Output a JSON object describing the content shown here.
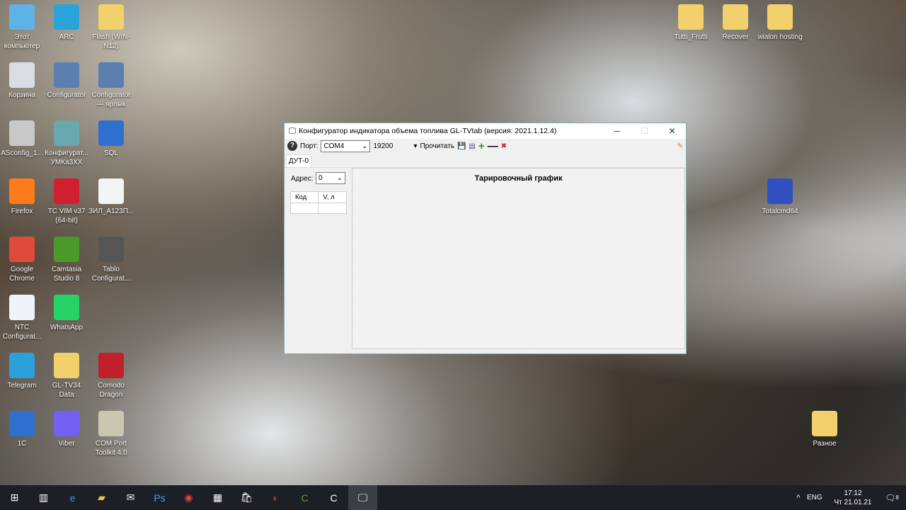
{
  "desktop_icons": [
    {
      "label": "Этот компьютер",
      "icon": "computer-icon",
      "color": "#5bb3e8"
    },
    {
      "label": "ARC",
      "icon": "arc-icon",
      "color": "#2aa3d8"
    },
    {
      "label": "Flash (WIN-N12)",
      "icon": "folder-icon",
      "color": "#f2d06b"
    },
    {
      "label": "Корзина",
      "icon": "recycle-bin-icon",
      "color": "#d8dde3"
    },
    {
      "label": "Configurator",
      "icon": "tools-icon",
      "color": "#5a7fb0"
    },
    {
      "label": "Configurator — ярлык",
      "icon": "tools-icon",
      "color": "#5a7fb0"
    },
    {
      "label": "ASconfig_1...",
      "icon": "gear-icon",
      "color": "#c8c8c8"
    },
    {
      "label": "Конфигурат... УМКа3XX",
      "icon": "configurator-icon",
      "color": "#6aa8b0"
    },
    {
      "label": "SQL",
      "icon": "network-computer-icon",
      "color": "#2f6fd0"
    },
    {
      "label": "Firefox",
      "icon": "firefox-icon",
      "color": "#ff7a1a"
    },
    {
      "label": "TC VIM v37 (64-bit)",
      "icon": "vim-icon",
      "color": "#d02030"
    },
    {
      "label": "ЗИЛ_А123П...",
      "icon": "document-icon",
      "color": "#f4f4f4"
    },
    {
      "label": "Google Chrome",
      "icon": "chrome-icon",
      "color": "#e04a3a"
    },
    {
      "label": "Camtasia Studio 8",
      "icon": "camtasia-icon",
      "color": "#4a9a2a"
    },
    {
      "label": "Tablo Configurat...",
      "icon": "monitor-icon",
      "color": "#555555"
    },
    {
      "label": "NTC Configurat...",
      "icon": "cfg-icon",
      "color": "#eef4fa"
    },
    {
      "label": "WhatsApp",
      "icon": "whatsapp-icon",
      "color": "#25d366"
    },
    {
      "label": "Telegram",
      "icon": "telegram-icon",
      "color": "#2aa1da"
    },
    {
      "label": "GL-TV34 Data",
      "icon": "folder-icon",
      "color": "#f2d06b"
    },
    {
      "label": "Comodo Dragon",
      "icon": "comodo-icon",
      "color": "#c0202a"
    },
    {
      "label": "1C",
      "icon": "network-computer-icon",
      "color": "#2f6fd0"
    },
    {
      "label": "Viber",
      "icon": "viber-icon",
      "color": "#7360f2"
    },
    {
      "label": "COM Port Toolkit 4.0",
      "icon": "com-port-icon",
      "color": "#c8c8b0"
    },
    {
      "label": "Tutti_Frutti",
      "icon": "folder-icon",
      "color": "#f2d06b"
    },
    {
      "label": "Recover",
      "icon": "folder-icon",
      "color": "#f2d06b"
    },
    {
      "label": "wialon hosting",
      "icon": "folder-icon",
      "color": "#f2d06b"
    },
    {
      "label": "Totalcmd64",
      "icon": "totalcmd-icon",
      "color": "#3050c0"
    },
    {
      "label": "Разное",
      "icon": "folder-icon",
      "color": "#f2d06b"
    }
  ],
  "window": {
    "title": "Конфигуратор индикатора объема топлива GL-TVtab (версия: 2021.1.12.4)",
    "port_label": "Порт:",
    "port_value": "COM4",
    "baud_value": "19200",
    "read_label": "Прочитать",
    "tab": "ДУТ-0",
    "address_label": "Адрес:",
    "address_value": "0",
    "table_headers": [
      "Код",
      "V, л"
    ],
    "chart_title": "Тарировочный график"
  },
  "taskbar": {
    "lang": "ENG",
    "time": "17:12",
    "date": "Чт 21.01.21",
    "notifications": "8",
    "apps": [
      "start",
      "task-view",
      "edge",
      "explorer",
      "mail",
      "photoshop",
      "chrome",
      "calculator",
      "store",
      "comodo-dragon",
      "camtasia",
      "camtasia-recorder",
      "configurator"
    ]
  }
}
